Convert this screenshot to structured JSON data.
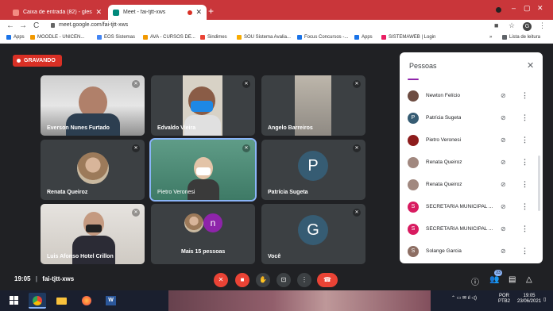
{
  "browser": {
    "tabs": [
      {
        "title": "Caixa de entrada (82) - glessamot",
        "close": "✕",
        "favicon_color": "#ea4335"
      },
      {
        "title": "Meet - fai-tjtt-xws",
        "close": "✕",
        "favicon_color": "#00897b"
      }
    ],
    "new_tab": "+",
    "window_controls": [
      "–",
      "▢",
      "✕"
    ],
    "url": "meet.google.com/fai-tjtt-xws",
    "nav": {
      "back": "←",
      "forward": "→",
      "reload": "C"
    },
    "profile_letter": "G",
    "bookmarks": [
      {
        "label": "Apps",
        "color": "#1a73e8"
      },
      {
        "label": "MOODLE - UNICEN...",
        "color": "#f29900"
      },
      {
        "label": "EOS Sistemas",
        "color": "#4285f4"
      },
      {
        "label": "AVA - CURSOS DE...",
        "color": "#f29900"
      },
      {
        "label": "Sindimes",
        "color": "#ea4335"
      },
      {
        "label": "SOU Sistema Avalia...",
        "color": "#f9ab00"
      },
      {
        "label": "Focus Concursos -...",
        "color": "#1a73e8"
      },
      {
        "label": "Apps",
        "color": "#1a73e8"
      },
      {
        "label": "SISTEMAWEB | Login",
        "color": "#e91e63"
      }
    ],
    "bookmarks_more": "»",
    "reading_list": "Lista de leitura"
  },
  "meet": {
    "recording_label": "GRAVANDO",
    "tiles": [
      {
        "name": "Everson Nunes Furtado",
        "kind": "video"
      },
      {
        "name": "Edvaldo Vieira",
        "kind": "video"
      },
      {
        "name": "Angelo Barreiros",
        "kind": "video"
      },
      {
        "name": "Renata Queiroz",
        "kind": "photo"
      },
      {
        "name": "Pietro Veronesi",
        "kind": "video"
      },
      {
        "name": "Patrícia Sugeta",
        "kind": "initial",
        "initial": "P"
      },
      {
        "name": "Luis Afonso Hotel Crillon",
        "kind": "video"
      },
      {
        "name": "Mais 15 pessoas",
        "kind": "more",
        "initial": "n"
      },
      {
        "name": "Você",
        "kind": "initial",
        "initial": "G"
      }
    ],
    "meeting_time": "19:05",
    "meeting_code": "fai-tjtt-xws",
    "participant_count": "23",
    "controls": {
      "mic": "mic-off",
      "camera": "cam-off",
      "raise_hand": "hand",
      "present": "present",
      "more": "more",
      "end": "end-call"
    }
  },
  "people_panel": {
    "title": "Pessoas",
    "close": "✕",
    "people": [
      {
        "name": "Newton Felício",
        "avatar": "photo",
        "color": "#6d4c41"
      },
      {
        "name": "Patrícia Sugeta",
        "avatar": "P",
        "color": "#365c73"
      },
      {
        "name": "Pietro Veronesi",
        "avatar": "photo",
        "color": "#8d1c1c"
      },
      {
        "name": "Renata Queiroz",
        "avatar": "photo",
        "color": "#a1887f"
      },
      {
        "name": "Renata Queiroz",
        "avatar": "photo",
        "color": "#a1887f"
      },
      {
        "name": "SECRETARIA MUNICIPAL ...",
        "avatar": "S",
        "color": "#d81b60"
      },
      {
        "name": "SECRETARIA MUNICIPAL ...",
        "avatar": "S",
        "color": "#d81b60"
      },
      {
        "name": "Solange Garcia",
        "avatar": "S",
        "color": "#8d6e63"
      }
    ]
  },
  "taskbar": {
    "language": "POR",
    "layout": "PTB2",
    "time": "19:05",
    "date": "23/06/2021"
  }
}
